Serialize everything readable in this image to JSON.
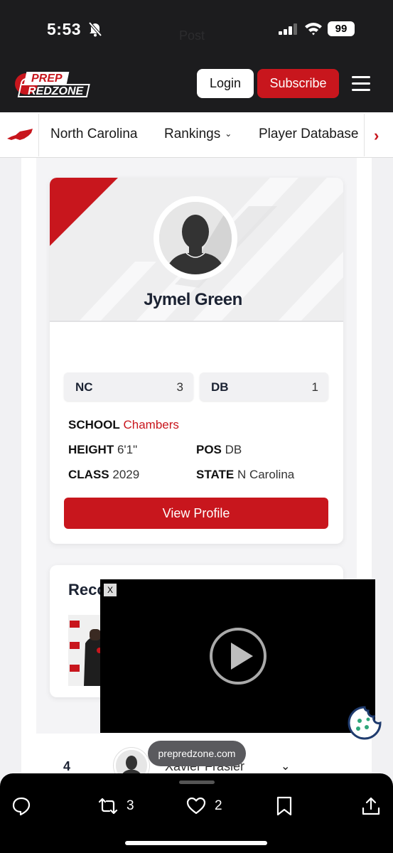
{
  "status_bar": {
    "time": "5:53",
    "battery": "99",
    "ghost_text": "Post"
  },
  "header": {
    "logo_top": "PREP",
    "logo_bottom": "REDZONE",
    "login_label": "Login",
    "subscribe_label": "Subscribe",
    "brand_color": "#c8161d"
  },
  "subnav": {
    "items": [
      {
        "label": "North Carolina"
      },
      {
        "label": "Rankings"
      },
      {
        "label": "Player Database"
      }
    ],
    "rankings_chevron": "⌄",
    "next_arrow": "›"
  },
  "player_card": {
    "name": "Jymel Green",
    "rank_state_label": "NC",
    "rank_state_value": "3",
    "rank_pos_label": "DB",
    "rank_pos_value": "1",
    "school_label": "SCHOOL",
    "school_value": "Chambers",
    "height_label": "HEIGHT",
    "height_value": "6'1\"",
    "pos_label": "POS",
    "pos_value": "DB",
    "class_label": "CLASS",
    "class_value": "2029",
    "state_label": "STATE",
    "state_value": "N Carolina",
    "view_profile_label": "View Profile"
  },
  "second_card": {
    "title": "Reco"
  },
  "ranking_row": {
    "number": "4",
    "name": "Xavier Frasier",
    "chevron": "⌄"
  },
  "video_ad": {
    "close_label": "X"
  },
  "url_pill": "prepredzone.com",
  "bottom_bar": {
    "retweet_count": "3",
    "like_count": "2"
  },
  "icons": [
    "bell-slash-icon",
    "signal-icon",
    "wifi-icon",
    "hamburger-menu-icon",
    "nc-state-icon",
    "chevron-right-icon",
    "play-icon",
    "cookie-icon",
    "reply-icon",
    "retweet-icon",
    "heart-icon",
    "bookmark-icon",
    "share-icon"
  ]
}
